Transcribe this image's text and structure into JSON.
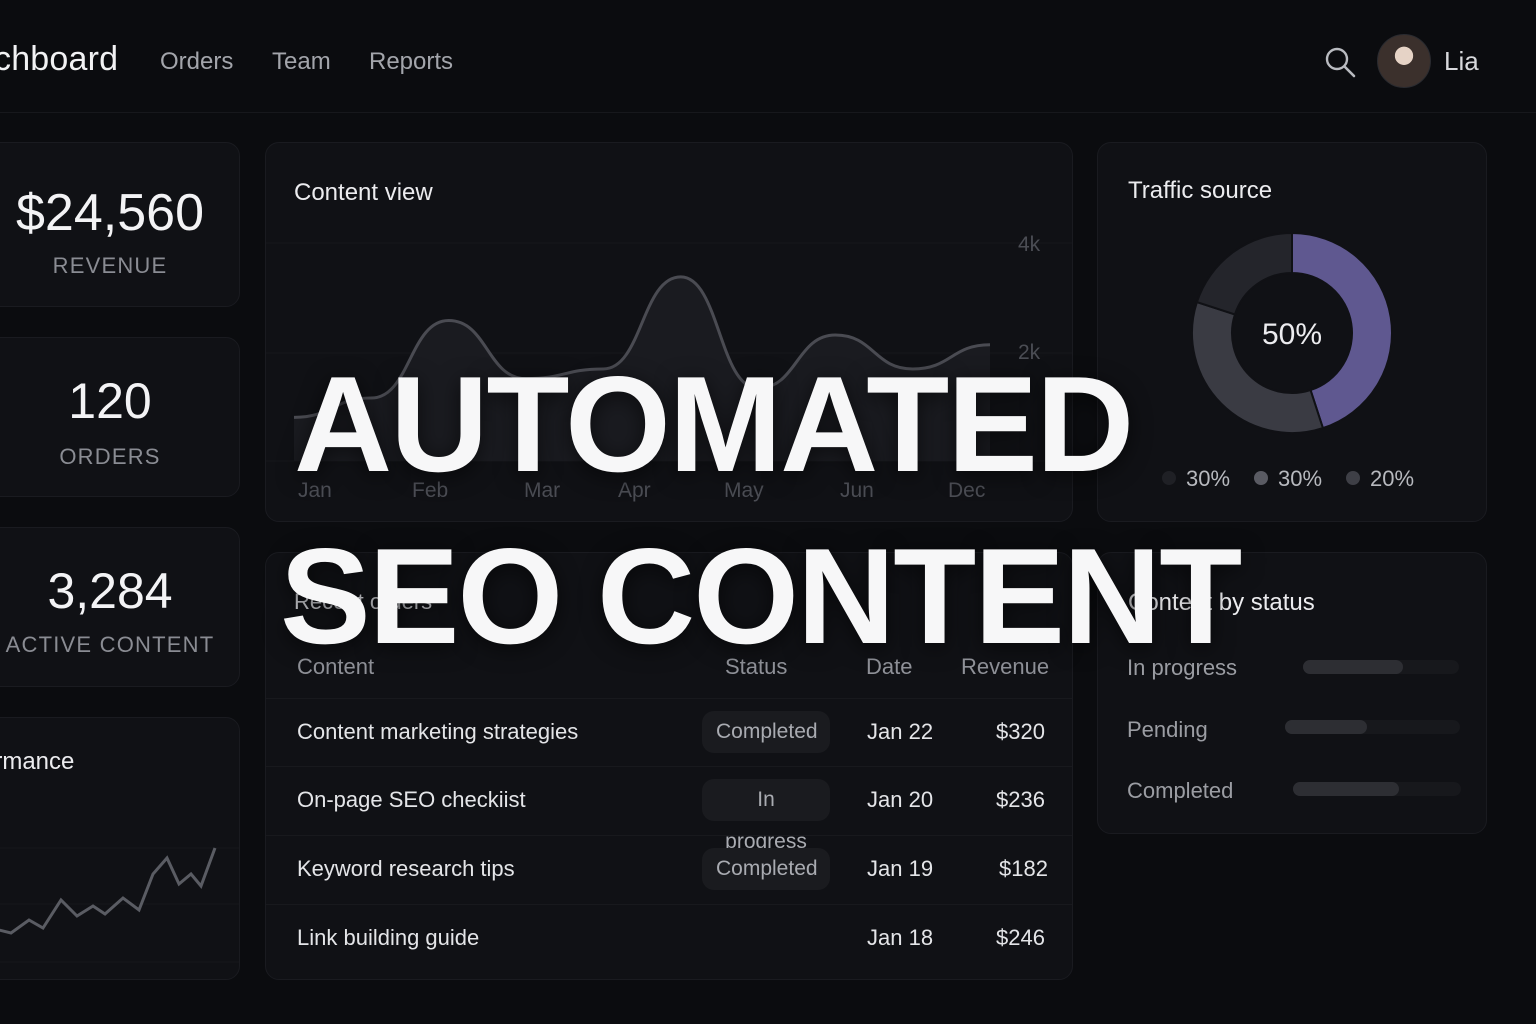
{
  "header": {
    "brand": "chboard",
    "nav": [
      "Orders",
      "Team",
      "Reports"
    ],
    "user_name": "Lia"
  },
  "stats": [
    {
      "value": "$24,560",
      "label": "REVENUE"
    },
    {
      "value": "120",
      "label": "ORDERS"
    },
    {
      "value": "3,284",
      "label": "ACTIVE CONTENT"
    }
  ],
  "performance": {
    "title": "ormance"
  },
  "content_view": {
    "title": "Content view",
    "chart_data": {
      "type": "area",
      "x_ticks": [
        "Jan",
        "Feb",
        "Mar",
        "Apr",
        "May",
        "Jun",
        "Dec"
      ],
      "y_ticks": [
        "4k",
        "2k"
      ],
      "values": [
        900,
        1300,
        2900,
        1700,
        1900,
        3800,
        1500,
        2600,
        1900,
        2400
      ]
    }
  },
  "traffic_source": {
    "title": "Traffic source",
    "center_label": "50%",
    "chart_data": {
      "type": "pie",
      "values": [
        45,
        35,
        20
      ],
      "colors": [
        "#5f5890",
        "#3a3b43",
        "#24252b"
      ]
    },
    "legend": [
      {
        "label": "30%",
        "color": "#1f2025"
      },
      {
        "label": "30%",
        "color": "#5a5b63"
      },
      {
        "label": "20%",
        "color": "#3e3f46"
      }
    ]
  },
  "recent_orders": {
    "title": "Recent orders",
    "columns": [
      "Content",
      "Status",
      "Date",
      "Revenue"
    ],
    "rows": [
      {
        "content": "Content marketing strategies",
        "status": "Completed",
        "date": "Jan 22",
        "revenue": "$320"
      },
      {
        "content": "On-page SEO checkiist",
        "status": "In progress",
        "date": "Jan 20",
        "revenue": "$236"
      },
      {
        "content": "Keyword research tips",
        "status": "Completed",
        "date": "Jan 19",
        "revenue": "$182"
      },
      {
        "content": "Link building guide",
        "status": "",
        "date": "Jan 18",
        "revenue": "$246"
      }
    ]
  },
  "content_by_status": {
    "title": "Content by status",
    "items": [
      {
        "label": "In progress",
        "fill": 0.64
      },
      {
        "label": "Pending",
        "fill": 0.47
      },
      {
        "label": "Completed",
        "fill": 0.63
      }
    ]
  },
  "overlay": {
    "line1": "AUTOMATED",
    "line2": "SEO CONTENT"
  }
}
